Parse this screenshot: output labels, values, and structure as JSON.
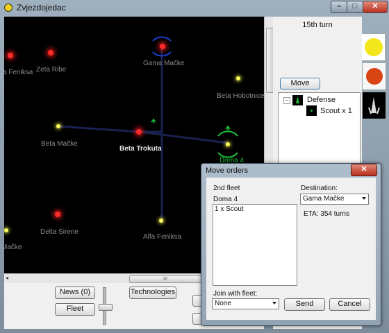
{
  "window": {
    "title": "Zvjezdojedac",
    "min": "–",
    "max": "□",
    "close": "✕"
  },
  "map": {
    "stars": [
      {
        "name": "a Feniksa",
        "color": "red"
      },
      {
        "name": "Zeta Ribe",
        "color": "red"
      },
      {
        "name": "Gama Mačke",
        "color": "red"
      },
      {
        "name": "Beta Hobotnice",
        "color": "yellow"
      },
      {
        "name": "Beta Mačke",
        "color": "yellow"
      },
      {
        "name": "Beta Trokuta",
        "color": "red"
      },
      {
        "name": "Doma 4",
        "color": "yellow"
      },
      {
        "name": "Delta Sirene",
        "color": "red"
      },
      {
        "name": "Alfa Feniksa",
        "color": "yellow"
      },
      {
        "name": "Mačke",
        "color": "yellow"
      }
    ]
  },
  "bottom": {
    "news": "News (0)",
    "fleet": "Fleet",
    "technologies": "Technologies",
    "hscroll_grip": "III"
  },
  "right": {
    "turn": "15th turn",
    "move": "Move",
    "tree": {
      "root": "Defense",
      "child": "Scout x 1"
    }
  },
  "dialog": {
    "title": "Move orders",
    "close": "✕",
    "fleet_name": "2nd fleet",
    "location": "Doma 4",
    "units": [
      "1 x Scout"
    ],
    "destination_label": "Destination:",
    "destination_value": "Gama Mačke",
    "eta": "ETA: 354 turns",
    "join_label": "Join with fleet:",
    "join_value": "None",
    "send": "Send",
    "cancel": "Cancel"
  }
}
